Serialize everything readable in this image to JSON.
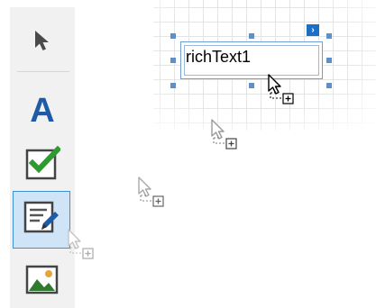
{
  "toolbox": {
    "items": [
      {
        "name": "pointer",
        "icon": "arrow-pointer-icon",
        "selected": false
      },
      {
        "name": "label",
        "icon": "letter-a-icon",
        "glyph": "A",
        "selected": false
      },
      {
        "name": "checkbox",
        "icon": "checkbox-checked-icon",
        "selected": false
      },
      {
        "name": "rich-text",
        "icon": "rich-text-edit-icon",
        "selected": true
      },
      {
        "name": "picture-box",
        "icon": "picture-icon",
        "selected": false
      }
    ]
  },
  "design_surface": {
    "control": {
      "type": "rich-text",
      "text": "richText1",
      "smart_tag_glyph": "›"
    }
  },
  "cursors": [
    {
      "icon": "drag-copy-cursor-icon"
    },
    {
      "icon": "drag-copy-cursor-icon"
    },
    {
      "icon": "drag-copy-cursor-icon"
    },
    {
      "icon": "drag-copy-cursor-icon"
    }
  ],
  "colors": {
    "accent": "#1f5aa6",
    "selection": "#3e8fd6",
    "checkmark": "#2f9a2f",
    "handle": "#5f8fc9"
  }
}
